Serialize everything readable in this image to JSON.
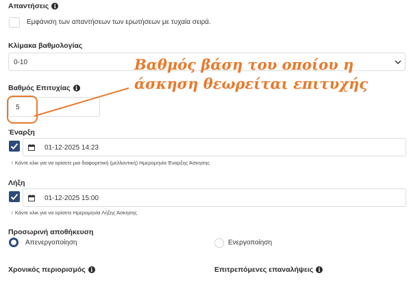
{
  "answers": {
    "label": "Απαντήσεις",
    "shuffle_label": "Εμφάνιση των απαντήσεων των ερωτήσεων με τυχαία σειρά."
  },
  "grading_scale": {
    "label": "Κλίμακα βαθμολογίας",
    "value": "0-10"
  },
  "pass_grade": {
    "label": "Βαθμός Επιτυχίας",
    "value": "5"
  },
  "annotation": {
    "line1": "Βαθμός βάση του οποίου  η",
    "line2": "άσκηση θεωρείται επιτυχής",
    "color": "#e8792a"
  },
  "start": {
    "label": "Έναρξη",
    "datetime": "01-12-2025 14:23",
    "hint": "Κάντε κλικ για να ορίσετε μια διαφορετική (μελλοντική) Ημερομηνία Έναρξης Άσκησης"
  },
  "end": {
    "label": "Λήξη",
    "datetime": "01-12-2025 15:00",
    "hint": "Κάντε κλικ για να ορίσετε Ημερομηνία Λήξης Άσκησης"
  },
  "autosave": {
    "label": "Προσωρινή αποθήκευση",
    "options": [
      "Απενεργοποίηση",
      "Ενεργοποίηση"
    ],
    "selected": "Απενεργοποίηση"
  },
  "time_limit": {
    "label": "Χρονικός περιορισμός"
  },
  "allowed_repeats": {
    "label": "Επιτρεπόμενες επαναλήψεις"
  },
  "colors": {
    "accent": "#2d4a78",
    "annotation": "#e8792a"
  }
}
